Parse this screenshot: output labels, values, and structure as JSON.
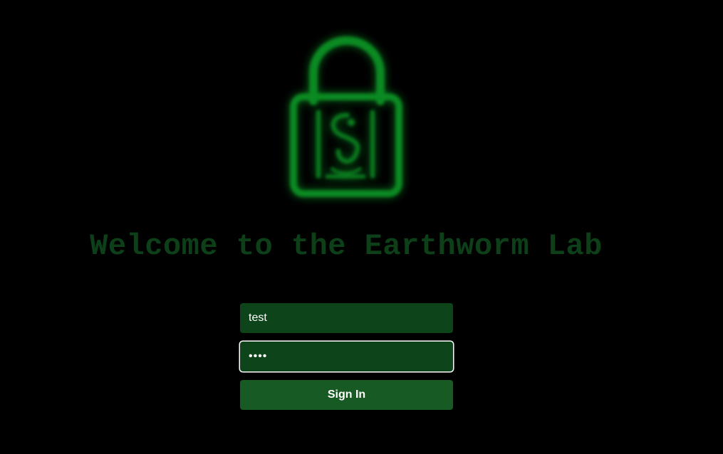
{
  "title": "Welcome to the Earthworm Lab",
  "login": {
    "username_value": "test",
    "password_masked": "••••",
    "sign_in_label": "Sign In"
  },
  "colors": {
    "background": "#000000",
    "glow_green": "#0a7a1e",
    "title_green": "#0d3f18",
    "field_bg": "#0e441a",
    "button_bg": "#185a23"
  },
  "icons": {
    "hero": "padlock-icon"
  }
}
